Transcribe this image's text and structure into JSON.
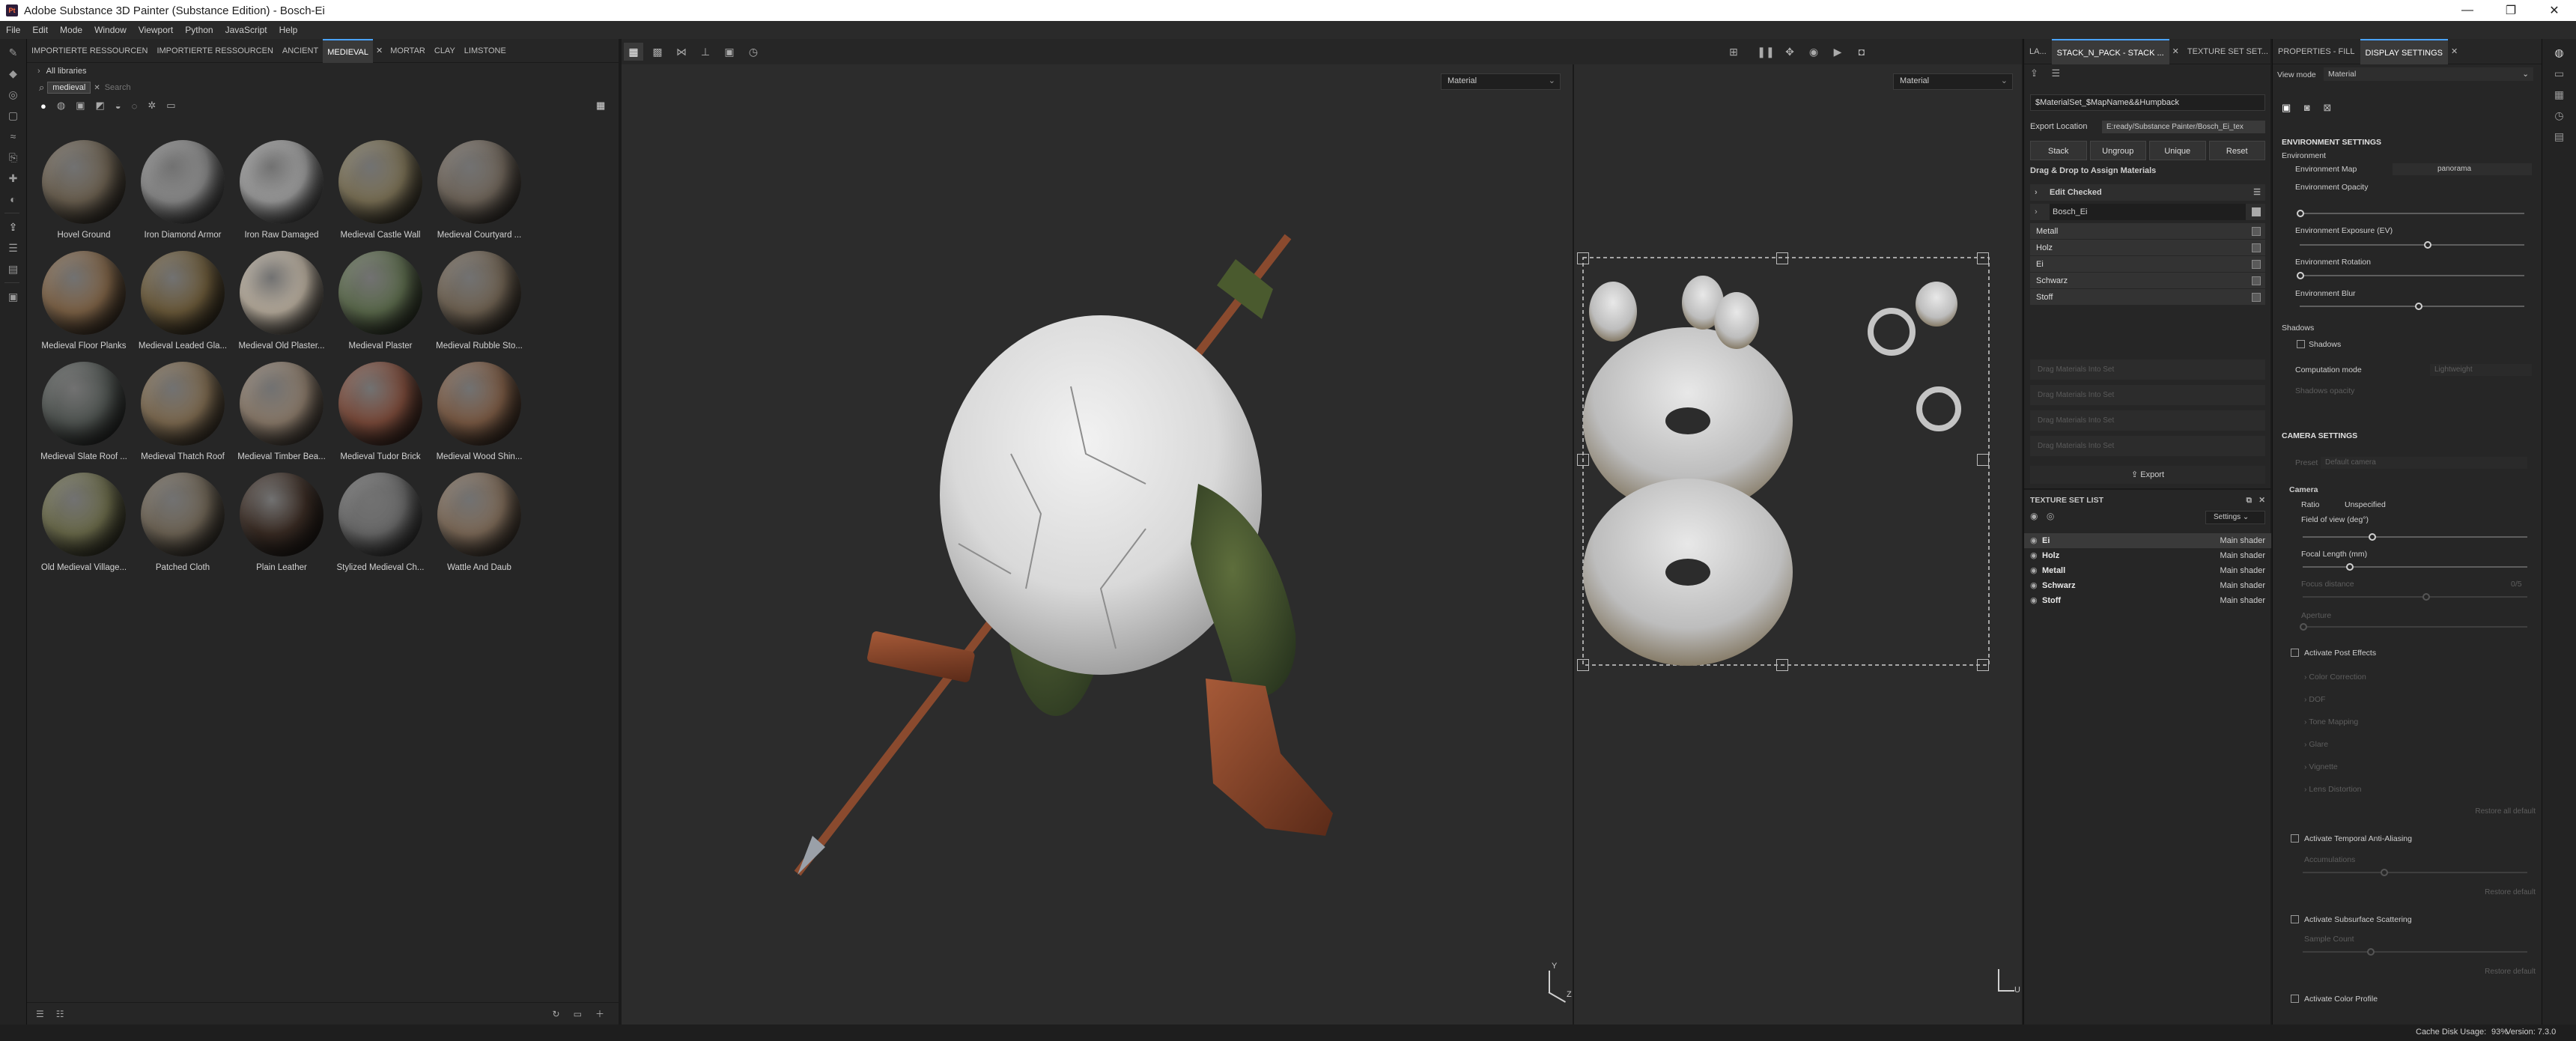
{
  "window": {
    "title": "Adobe Substance 3D Painter (Substance Edition) - Bosch-Ei",
    "minimize": "—",
    "maximize": "❐",
    "close": "✕"
  },
  "menu": [
    "File",
    "Edit",
    "Mode",
    "Window",
    "Viewport",
    "Python",
    "JavaScript",
    "Help"
  ],
  "assets": {
    "tabs": [
      "IMPORTIERTE RESSOURCEN",
      "IMPORTIERTE RESSOURCEN",
      "ANCIENT",
      "MEDIEVAL",
      "MORTAR",
      "CLAY",
      "LIMSTONE"
    ],
    "active_tab": "MEDIEVAL",
    "library": "All libraries",
    "filter_chip": "medieval",
    "search_placeholder": "Search",
    "materials": [
      {
        "name": "Hovel Ground",
        "color": "#6b6050"
      },
      {
        "name": "Iron Diamond Armor",
        "color": "#8a8a8a"
      },
      {
        "name": "Iron Raw Damaged",
        "color": "#9c9c9c"
      },
      {
        "name": "Medieval Castle Wall",
        "color": "#7a7055"
      },
      {
        "name": "Medieval Courtyard ...",
        "color": "#6f655a"
      },
      {
        "name": "Medieval Floor Planks",
        "color": "#7d6246"
      },
      {
        "name": "Medieval Leaded Gla...",
        "color": "#6b5a3a"
      },
      {
        "name": "Medieval Old Plaster...",
        "color": "#b8ad9d"
      },
      {
        "name": "Medieval Plaster",
        "color": "#5b6a4c"
      },
      {
        "name": "Medieval Rubble Sto...",
        "color": "#6f6252"
      },
      {
        "name": "Medieval Slate Roof ...",
        "color": "#505552"
      },
      {
        "name": "Medieval Thatch Roof",
        "color": "#7d6a50"
      },
      {
        "name": "Medieval Timber Bea...",
        "color": "#8a7a6a"
      },
      {
        "name": "Medieval Tudor Brick",
        "color": "#7a4a3a"
      },
      {
        "name": "Medieval Wood Shin...",
        "color": "#7a5a44"
      },
      {
        "name": "Old Medieval Village...",
        "color": "#6a6a4a"
      },
      {
        "name": "Patched Cloth",
        "color": "#6e6455"
      },
      {
        "name": "Plain Leather",
        "color": "#3a2c24"
      },
      {
        "name": "Stylized Medieval Ch...",
        "color": "#6a6a6a"
      },
      {
        "name": "Wattle And Daub",
        "color": "#7d6a58"
      }
    ]
  },
  "viewport": {
    "left_mode": "Material",
    "right_mode": "Material",
    "axis_labels": [
      "Y",
      "Z",
      "U"
    ]
  },
  "layers": {
    "tabs": [
      "LA...",
      "STACK_N_PACK - STACK ...",
      "TEXTURE SET SET..."
    ],
    "pattern": "$MaterialSet_$MapName&&Humpback",
    "export_location_label": "Export Location",
    "export_location_value": "E:ready/Substance Painter/Bosch_Ei_tex",
    "buttons": [
      "Stack",
      "Ungroup",
      "Unique",
      "Reset"
    ],
    "drag_drop_label": "Drag & Drop to Assign Materials",
    "edit_checked": "Edit Checked",
    "group_name": "Bosch_Ei",
    "materials": [
      "Metall",
      "Holz",
      "Ei",
      "Schwarz",
      "Stoff"
    ],
    "drop_placeholder": "Drag Materials Into Set",
    "export_label": "Export"
  },
  "texture_set_list": {
    "title": "TEXTURE SET LIST",
    "settings_label": "Settings",
    "sets": [
      {
        "name": "Ei",
        "shader": "Main shader"
      },
      {
        "name": "Holz",
        "shader": "Main shader"
      },
      {
        "name": "Metall",
        "shader": "Main shader"
      },
      {
        "name": "Schwarz",
        "shader": "Main shader"
      },
      {
        "name": "Stoff",
        "shader": "Main shader"
      }
    ]
  },
  "properties": {
    "tabs": [
      "PROPERTIES - FILL",
      "DISPLAY SETTINGS"
    ],
    "view_mode_label": "View mode",
    "view_mode_value": "Material",
    "environment_settings": "ENVIRONMENT SETTINGS",
    "environment": "Environment",
    "environment_map_label": "Environment Map",
    "environment_map_value": "panorama",
    "environment_opacity": "Environment Opacity",
    "environment_exposure": "Environment Exposure (EV)",
    "environment_rotation": "Environment Rotation",
    "environment_blur": "Environment Blur",
    "shadows_header": "Shadows",
    "shadows": "Shadows",
    "computation_mode": "Computation mode",
    "computation_value": "Lightweight",
    "shadows_opacity": "Shadows opacity",
    "camera_settings": "CAMERA SETTINGS",
    "preset_label": "Preset",
    "preset_value": "Default camera",
    "camera": "Camera",
    "ratio_label": "Ratio",
    "ratio_value": "Unspecified",
    "fov": "Field of view (deg°)",
    "focal": "Focal Length (mm)",
    "focus_distance": "Focus distance",
    "focus_value": "0/5",
    "aperture": "Aperture",
    "post_effects": "Activate Post Effects",
    "post_items": [
      "Color Correction",
      "DOF",
      "Tone Mapping",
      "Glare",
      "Vignette",
      "Lens Distortion"
    ],
    "restore": "Restore all default",
    "taa": "Activate Temporal Anti-Aliasing",
    "accumulations": "Accumulations",
    "restore_default": "Restore default",
    "sss": "Activate Subsurface Scattering",
    "sample_count": "Sample Count",
    "color_profile": "Activate Color Profile"
  },
  "status": {
    "cache": "Cache Disk Usage:",
    "cache_value": "93%",
    "version": "Version: 7.3.0"
  }
}
